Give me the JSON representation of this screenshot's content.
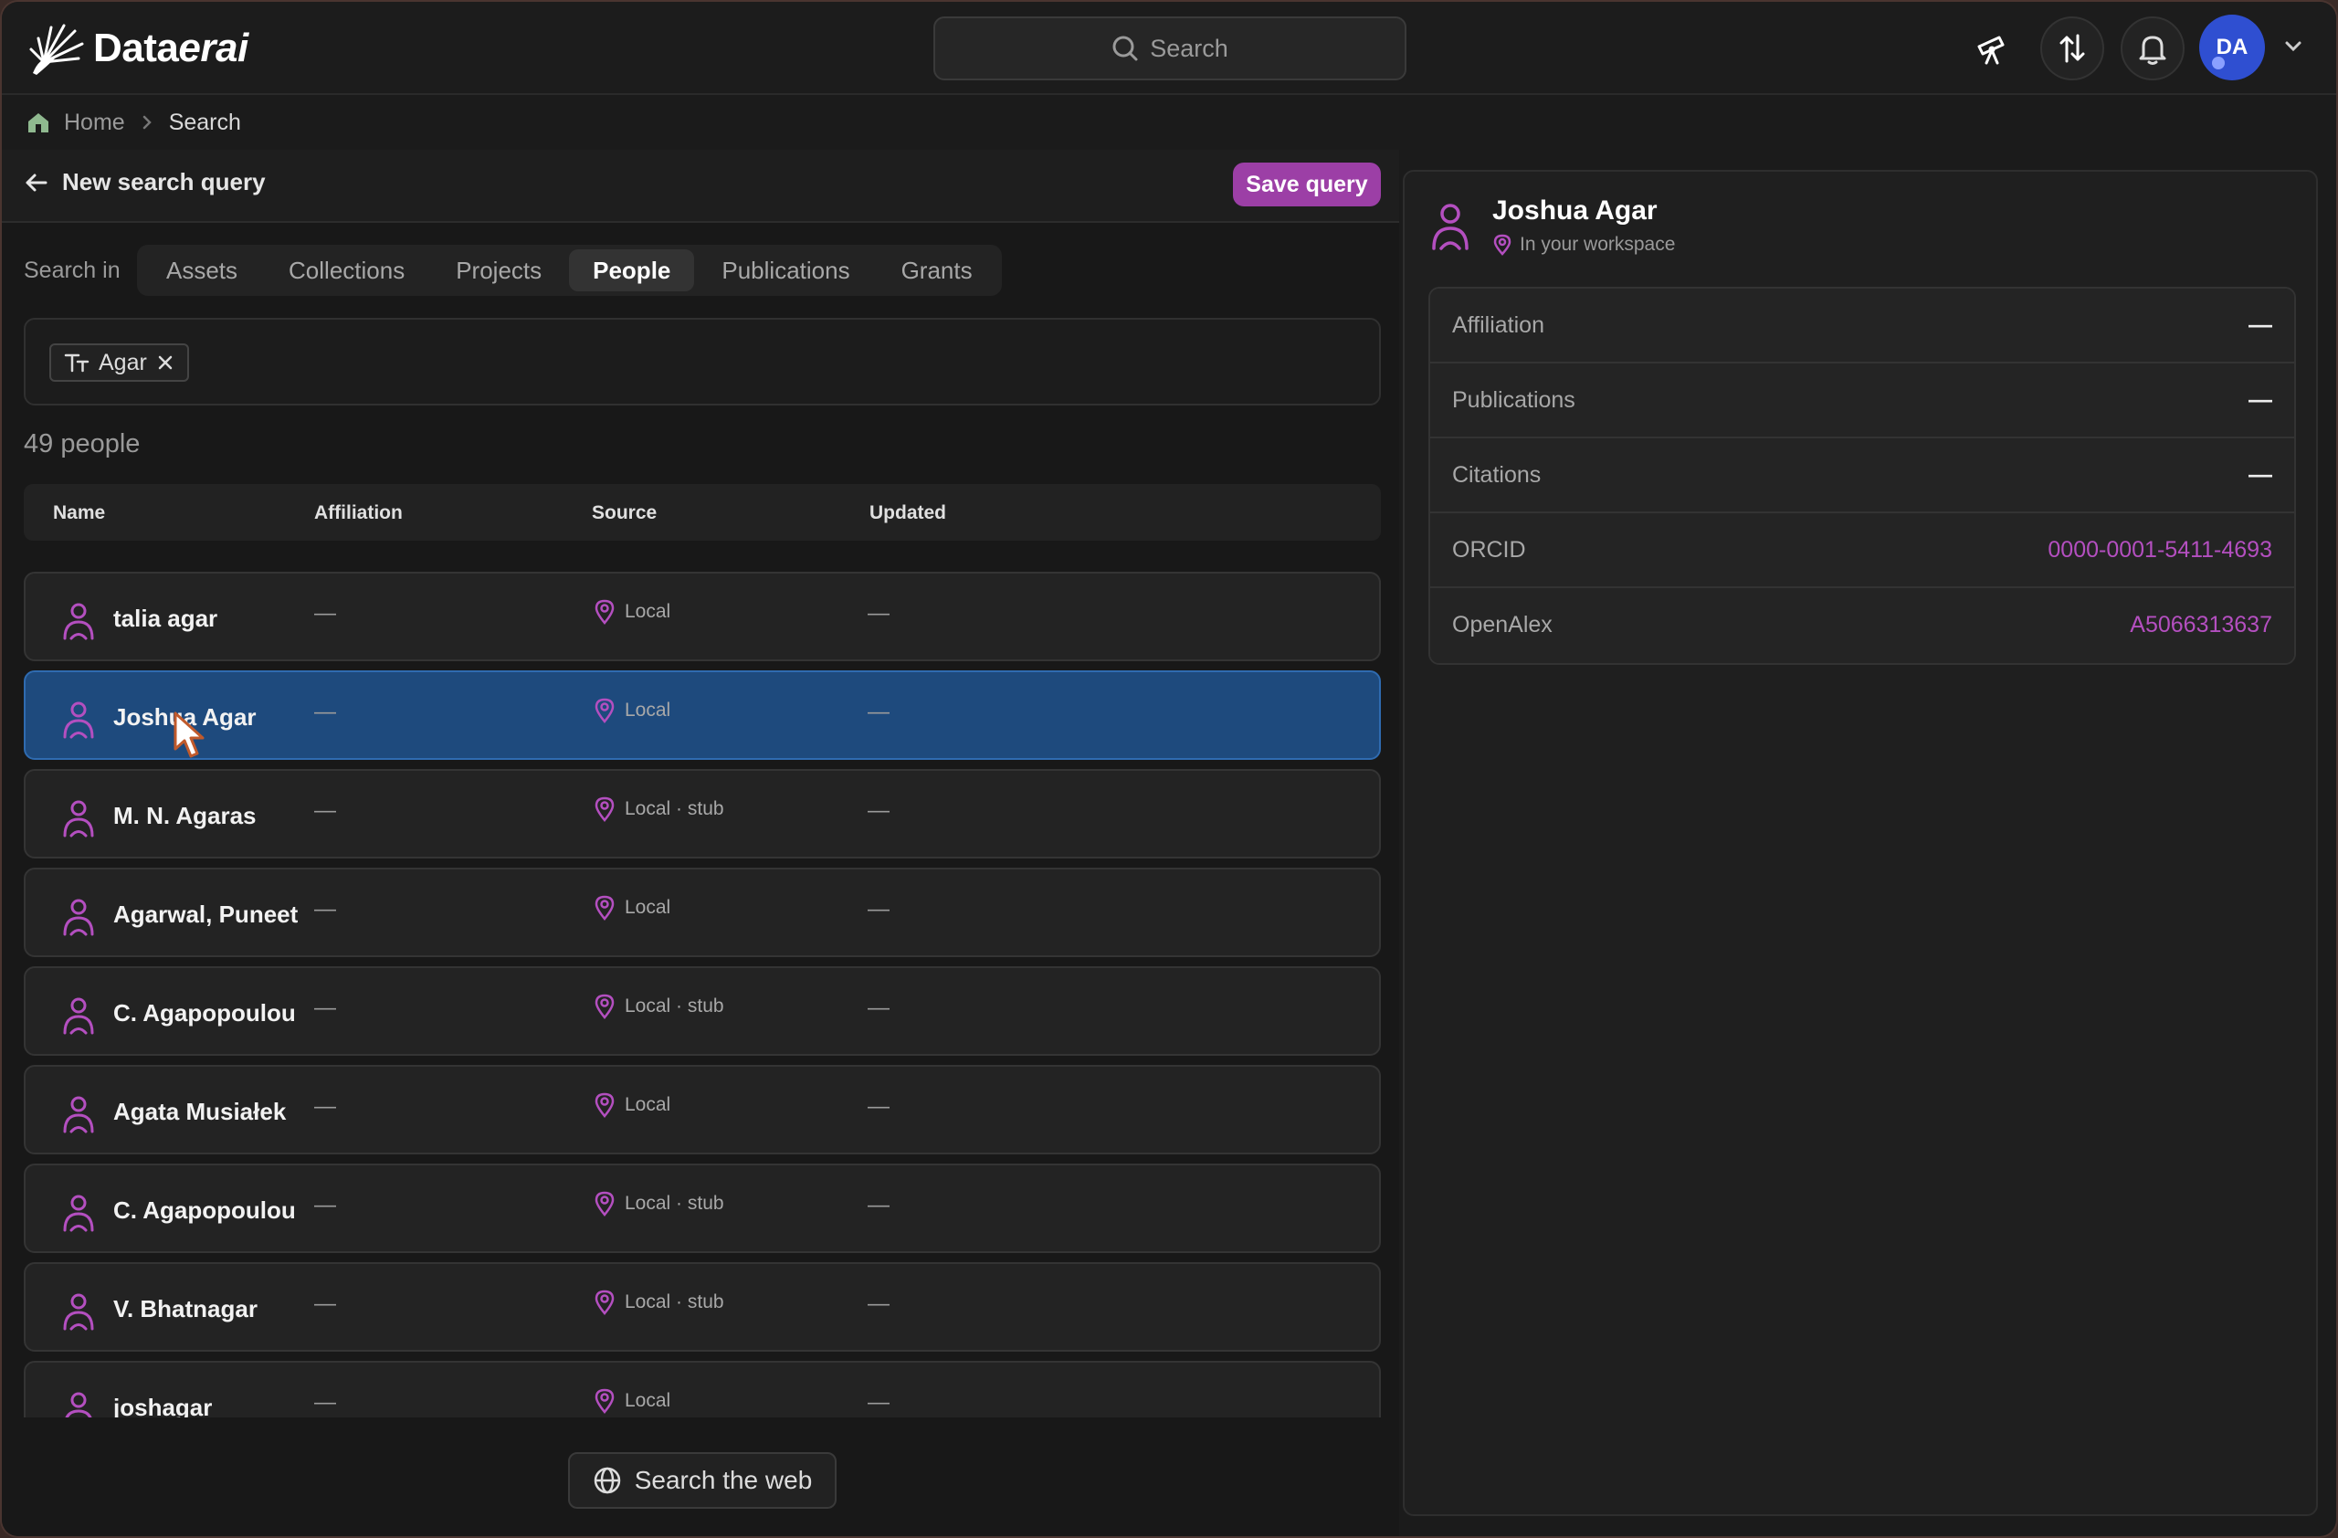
{
  "app": {
    "name_prefix": "Data",
    "name_suffix": "erai"
  },
  "search": {
    "placeholder": "Search"
  },
  "user": {
    "initials": "DA"
  },
  "breadcrumb": {
    "home": "Home",
    "current": "Search"
  },
  "query": {
    "back_label": "New search query",
    "save_label": "Save query"
  },
  "search_in": {
    "label": "Search in",
    "tabs": [
      "Assets",
      "Collections",
      "Projects",
      "People",
      "Publications",
      "Grants"
    ],
    "active": "People"
  },
  "filter": {
    "chip_label": "Agar"
  },
  "results": {
    "count_label": "49 people"
  },
  "table": {
    "headers": {
      "name": "Name",
      "affiliation": "Affiliation",
      "source": "Source",
      "updated": "Updated"
    },
    "rows": [
      {
        "name": "talia agar",
        "affiliation": "—",
        "source": "Local",
        "updated": "—"
      },
      {
        "name": "Joshua Agar",
        "affiliation": "—",
        "source": "Local",
        "updated": "—",
        "selected": true
      },
      {
        "name": "M. N. Agaras",
        "affiliation": "—",
        "source": "Local · stub",
        "updated": "—"
      },
      {
        "name": "Agarwal, Puneet",
        "affiliation": "—",
        "source": "Local",
        "updated": "—"
      },
      {
        "name": "C. Agapopoulou",
        "affiliation": "—",
        "source": "Local · stub",
        "updated": "—"
      },
      {
        "name": "Agata Musiałek",
        "affiliation": "—",
        "source": "Local",
        "updated": "—"
      },
      {
        "name": "C. Agapopoulou",
        "affiliation": "—",
        "source": "Local · stub",
        "updated": "—"
      },
      {
        "name": "V. Bhatnagar",
        "affiliation": "—",
        "source": "Local · stub",
        "updated": "—"
      },
      {
        "name": "joshagar",
        "affiliation": "—",
        "source": "Local",
        "updated": "—"
      }
    ]
  },
  "web_search": {
    "label": "Search the web"
  },
  "detail": {
    "name": "Joshua Agar",
    "location": "In your workspace",
    "properties": [
      {
        "key": "Affiliation",
        "value": "—",
        "is_dash": true
      },
      {
        "key": "Publications",
        "value": "—",
        "is_dash": true
      },
      {
        "key": "Citations",
        "value": "—",
        "is_dash": true
      },
      {
        "key": "ORCID",
        "value": "0000-0001-5411-4693",
        "is_dash": false
      },
      {
        "key": "OpenAlex",
        "value": "A5066313637",
        "is_dash": false
      }
    ]
  },
  "colors": {
    "accent": "#9c3fa6",
    "link": "#b44fc0",
    "selected_row": "#1e4a7d",
    "avatar": "#2f4fd1"
  },
  "icons": [
    "logo-burst-icon",
    "search-icon",
    "telescope-icon",
    "sync-icon",
    "bell-icon",
    "chevron-down-icon",
    "home-icon",
    "chevron-right-icon",
    "arrow-left-icon",
    "text-type-icon",
    "close-icon",
    "person-icon",
    "location-pin-icon",
    "globe-icon",
    "cursor-icon"
  ]
}
